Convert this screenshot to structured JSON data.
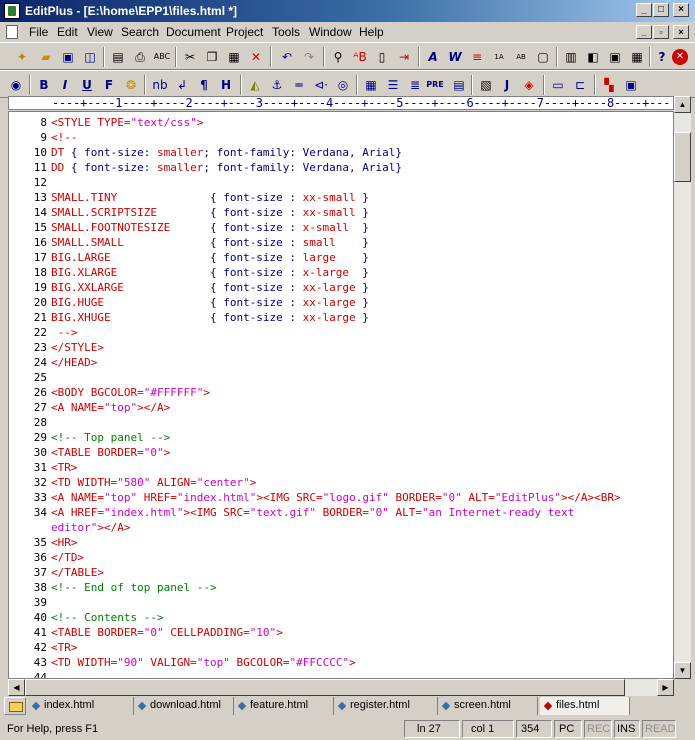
{
  "window": {
    "title": "EditPlus - [E:\\home\\EPP1\\files.html *]",
    "controls": {
      "minimize": "_",
      "maximize": "□",
      "close": "×"
    }
  },
  "menu": {
    "items": [
      "File",
      "Edit",
      "View",
      "Search",
      "Document",
      "Project",
      "Tools",
      "Window",
      "Help"
    ],
    "mdi_controls": {
      "minimize": "_",
      "restore": "▫",
      "close": "×"
    }
  },
  "toolbar1": {
    "icons": [
      "new-file-icon",
      "open-folder-icon",
      "save-icon",
      "save-all-icon",
      "print-preview-icon",
      "print-icon",
      "spell-check-icon",
      "cut-icon",
      "copy-icon",
      "paste-icon",
      "delete-icon",
      "undo-icon",
      "redo-icon",
      "find-icon",
      "replace-icon",
      "copy-to-icon",
      "insert-icon",
      "font-icon",
      "word-wrap-icon",
      "line-break-icon",
      "tab-icon",
      "spell-icon",
      "window-icon",
      "cliptext-icon",
      "output-icon",
      "browser-icon",
      "help-icon",
      "stop-icon"
    ]
  },
  "toolbar2": {
    "icons": [
      "browser-view-icon",
      "bold-icon",
      "italic-icon",
      "underline-icon",
      "font-tag-icon",
      "color-icon",
      "nbsp-icon",
      "br-icon",
      "paragraph-icon",
      "heading-icon",
      "paint-icon",
      "anchor-icon",
      "hr-icon",
      "comment-icon",
      "image-icon",
      "table-icon",
      "center-icon",
      "align-icon",
      "pre-icon",
      "form-icon",
      "javascript-icon",
      "plugin-icon",
      "frame-icon",
      "wrap-icon",
      "palette-icon",
      "layout-icon"
    ],
    "labels": {
      "bold": "B",
      "italic": "I",
      "underline": "U",
      "font": "F",
      "nbsp": "nb",
      "br": "↲",
      "paragraph": "¶",
      "heading": "H",
      "pre": "PRE",
      "javascript": "J"
    }
  },
  "ruler": {
    "text": "----+----1----+----2----+----3----+----4----+----5----+----6----+----7----+----8----+---"
  },
  "editor": {
    "lines": [
      {
        "num": "8",
        "code": [
          [
            "t-tag",
            "<STYLE "
          ],
          [
            "t-attr",
            "TYPE="
          ],
          [
            "t-str",
            "\"text/css\""
          ],
          [
            "t-tag",
            ">"
          ]
        ]
      },
      {
        "num": "9",
        "code": [
          [
            "t-tag",
            "<!--"
          ]
        ]
      },
      {
        "num": "10",
        "code": [
          [
            "t-sel",
            "DT "
          ],
          [
            "t-prop",
            "{ font-size: "
          ],
          [
            "t-sel",
            "smaller"
          ],
          [
            "t-prop",
            "; font-family: Verdana, Arial}"
          ]
        ]
      },
      {
        "num": "11",
        "code": [
          [
            "t-sel",
            "DD "
          ],
          [
            "t-prop",
            "{ font-size: "
          ],
          [
            "t-sel",
            "smaller"
          ],
          [
            "t-prop",
            "; font-family: Verdana, Arial}"
          ]
        ]
      },
      {
        "num": "12",
        "code": []
      },
      {
        "num": "13",
        "code": [
          [
            "t-sel",
            "SMALL.TINY              "
          ],
          [
            "t-prop",
            "{ font-size : "
          ],
          [
            "t-sel",
            "xx-small"
          ],
          [
            "t-prop",
            " }"
          ]
        ]
      },
      {
        "num": "14",
        "code": [
          [
            "t-sel",
            "SMALL.SCRIPTSIZE        "
          ],
          [
            "t-prop",
            "{ font-size : "
          ],
          [
            "t-sel",
            "xx-small"
          ],
          [
            "t-prop",
            " }"
          ]
        ]
      },
      {
        "num": "15",
        "code": [
          [
            "t-sel",
            "SMALL.FOOTNOTESIZE      "
          ],
          [
            "t-prop",
            "{ font-size : "
          ],
          [
            "t-sel",
            "x-small"
          ],
          [
            "t-prop",
            "  }"
          ]
        ]
      },
      {
        "num": "16",
        "code": [
          [
            "t-sel",
            "SMALL.SMALL             "
          ],
          [
            "t-prop",
            "{ font-size : "
          ],
          [
            "t-sel",
            "small"
          ],
          [
            "t-prop",
            "    }"
          ]
        ]
      },
      {
        "num": "17",
        "code": [
          [
            "t-sel",
            "BIG.LARGE               "
          ],
          [
            "t-prop",
            "{ font-size : "
          ],
          [
            "t-sel",
            "large"
          ],
          [
            "t-prop",
            "    }"
          ]
        ]
      },
      {
        "num": "18",
        "code": [
          [
            "t-sel",
            "BIG.XLARGE              "
          ],
          [
            "t-prop",
            "{ font-size : "
          ],
          [
            "t-sel",
            "x-large"
          ],
          [
            "t-prop",
            "  }"
          ]
        ]
      },
      {
        "num": "19",
        "code": [
          [
            "t-sel",
            "BIG.XXLARGE             "
          ],
          [
            "t-prop",
            "{ font-size : "
          ],
          [
            "t-sel",
            "xx-large"
          ],
          [
            "t-prop",
            " }"
          ]
        ]
      },
      {
        "num": "20",
        "code": [
          [
            "t-sel",
            "BIG.HUGE                "
          ],
          [
            "t-prop",
            "{ font-size : "
          ],
          [
            "t-sel",
            "xx-large"
          ],
          [
            "t-prop",
            " }"
          ]
        ]
      },
      {
        "num": "21",
        "code": [
          [
            "t-sel",
            "BIG.XHUGE               "
          ],
          [
            "t-prop",
            "{ font-size : "
          ],
          [
            "t-sel",
            "xx-large"
          ],
          [
            "t-prop",
            " }"
          ]
        ]
      },
      {
        "num": "22",
        "code": [
          [
            "t-tag",
            " -->"
          ]
        ]
      },
      {
        "num": "23",
        "code": [
          [
            "t-tag",
            "</STYLE>"
          ]
        ]
      },
      {
        "num": "24",
        "code": [
          [
            "t-tag",
            "</HEAD>"
          ]
        ]
      },
      {
        "num": "25",
        "code": []
      },
      {
        "num": "26",
        "code": [
          [
            "t-tag",
            "<BODY "
          ],
          [
            "t-attr",
            "BGCOLOR="
          ],
          [
            "t-str",
            "\"#FFFFFF\""
          ],
          [
            "t-tag",
            ">"
          ]
        ]
      },
      {
        "num": "27",
        "code": [
          [
            "t-tag",
            "<A "
          ],
          [
            "t-attr",
            "NAME="
          ],
          [
            "t-str",
            "\"top\""
          ],
          [
            "t-tag",
            "></A>"
          ]
        ]
      },
      {
        "num": "28",
        "code": []
      },
      {
        "num": "29",
        "code": [
          [
            "t-cmt",
            "<!-- Top panel -->"
          ]
        ]
      },
      {
        "num": "30",
        "code": [
          [
            "t-tag",
            "<TABLE "
          ],
          [
            "t-attr",
            "BORDER="
          ],
          [
            "t-str",
            "\"0\""
          ],
          [
            "t-tag",
            ">"
          ]
        ]
      },
      {
        "num": "31",
        "code": [
          [
            "t-tag",
            "<TR>"
          ]
        ]
      },
      {
        "num": "32",
        "code": [
          [
            "t-tag",
            "<TD "
          ],
          [
            "t-attr",
            "WIDTH="
          ],
          [
            "t-str",
            "\"580\""
          ],
          [
            "t-attr",
            " ALIGN="
          ],
          [
            "t-str",
            "\"center\""
          ],
          [
            "t-tag",
            ">"
          ]
        ]
      },
      {
        "num": "33",
        "code": [
          [
            "t-tag",
            "<A "
          ],
          [
            "t-attr",
            "NAME="
          ],
          [
            "t-str",
            "\"top\""
          ],
          [
            "t-attr",
            " HREF="
          ],
          [
            "t-str",
            "\"index.html\""
          ],
          [
            "t-tag",
            "><IMG "
          ],
          [
            "t-attr",
            "SRC="
          ],
          [
            "t-str",
            "\"logo.gif\""
          ],
          [
            "t-attr",
            " BORDER="
          ],
          [
            "t-str",
            "\"0\""
          ],
          [
            "t-attr",
            " ALT="
          ],
          [
            "t-str",
            "\"EditPlus\""
          ],
          [
            "t-tag",
            "></A><BR>"
          ]
        ]
      },
      {
        "num": "34",
        "code": [
          [
            "t-tag",
            "<A "
          ],
          [
            "t-attr",
            "HREF="
          ],
          [
            "t-str",
            "\"index.html\""
          ],
          [
            "t-tag",
            "><IMG "
          ],
          [
            "t-attr",
            "SRC="
          ],
          [
            "t-str",
            "\"text.gif\""
          ],
          [
            "t-attr",
            " BORDER="
          ],
          [
            "t-str",
            "\"0\""
          ],
          [
            "t-attr",
            " ALT="
          ],
          [
            "t-str",
            "\"an Internet-ready text"
          ]
        ]
      },
      {
        "num": "",
        "code": [
          [
            "t-str",
            "editor\""
          ],
          [
            "t-tag",
            "></A>"
          ]
        ]
      },
      {
        "num": "35",
        "code": [
          [
            "t-tag",
            "<HR>"
          ]
        ]
      },
      {
        "num": "36",
        "code": [
          [
            "t-tag",
            "</TD>"
          ]
        ]
      },
      {
        "num": "37",
        "code": [
          [
            "t-tag",
            "</TABLE>"
          ]
        ]
      },
      {
        "num": "38",
        "code": [
          [
            "t-cmt",
            "<!-- End of top panel -->"
          ]
        ]
      },
      {
        "num": "39",
        "code": []
      },
      {
        "num": "40",
        "code": [
          [
            "t-cmt",
            "<!-- Contents -->"
          ]
        ]
      },
      {
        "num": "41",
        "code": [
          [
            "t-tag",
            "<TABLE "
          ],
          [
            "t-attr",
            "BORDER="
          ],
          [
            "t-str",
            "\"0\""
          ],
          [
            "t-attr",
            " CELLPADDING="
          ],
          [
            "t-str",
            "\"10\""
          ],
          [
            "t-tag",
            ">"
          ]
        ]
      },
      {
        "num": "42",
        "code": [
          [
            "t-tag",
            "<TR>"
          ]
        ]
      },
      {
        "num": "43",
        "code": [
          [
            "t-tag",
            "<TD "
          ],
          [
            "t-attr",
            "WIDTH="
          ],
          [
            "t-str",
            "\"90\""
          ],
          [
            "t-attr",
            " VALIGN="
          ],
          [
            "t-str",
            "\"top\""
          ],
          [
            "t-attr",
            " BGCOLOR="
          ],
          [
            "t-str",
            "\"#FFCCCC\""
          ],
          [
            "t-tag",
            ">"
          ]
        ]
      },
      {
        "num": "44",
        "code": []
      }
    ]
  },
  "tabs": [
    {
      "label": "index.html",
      "active": false
    },
    {
      "label": "download.html",
      "active": false
    },
    {
      "label": "feature.html",
      "active": false
    },
    {
      "label": "register.html",
      "active": false
    },
    {
      "label": "screen.html",
      "active": false
    },
    {
      "label": "files.html",
      "active": true
    }
  ],
  "status": {
    "help": "For Help, press F1",
    "line": "ln 27",
    "col": "col 1",
    "count": "354",
    "mode": "PC",
    "rec": "REC",
    "ins": "INS",
    "read": "READ"
  },
  "colors": {
    "tag": "#cc0000",
    "string": "#cc00cc",
    "comment": "#008000",
    "property": "#000080",
    "title_bar": "#0a246a"
  }
}
